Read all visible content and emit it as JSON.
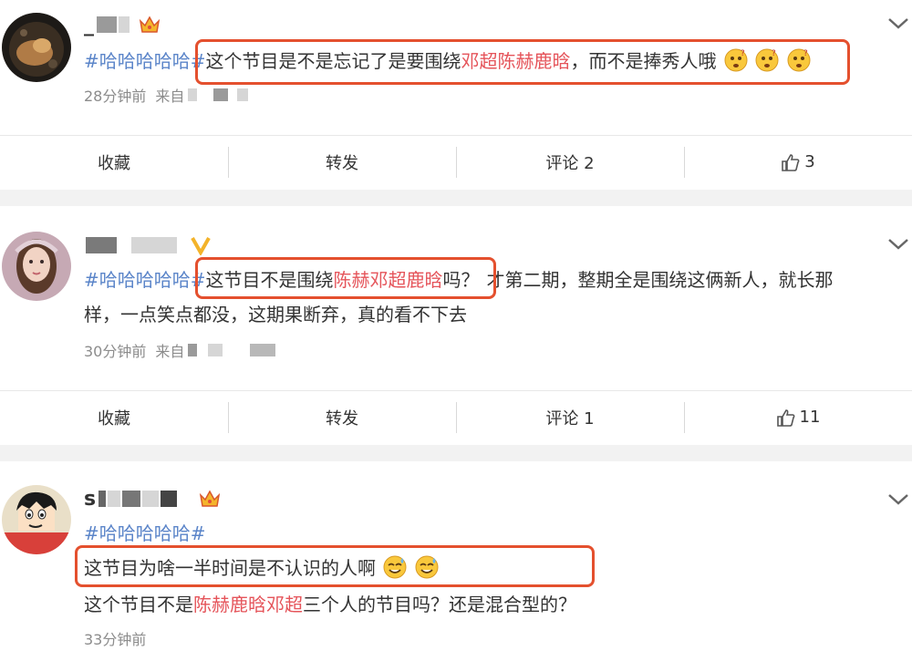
{
  "posts": [
    {
      "user_name": "_",
      "hashtag": "#哈哈哈哈哈#",
      "text_boxed_pre": "这个节目是不是忘记了是要围绕",
      "text_boxed_hl": "邓超陈赫鹿晗",
      "text_boxed_post": "，而不是捧秀人哦",
      "text_after": "",
      "time": "28分钟前",
      "source": "来自",
      "actions": {
        "favorite": "收藏",
        "repost": "转发",
        "comment": "评论 2",
        "like_count": "3"
      }
    },
    {
      "user_name": "",
      "hashtag": "#哈哈哈哈哈#",
      "text_boxed_pre": "这节目不是围绕",
      "text_boxed_hl": "陈赫邓超鹿晗",
      "text_boxed_post": "吗？",
      "text_after_line1": "才第二期，整期全是围绕这俩新人，就长那",
      "text_after_line2": "样，一点笑点都没，这期果断弃，真的看不下去",
      "time": "30分钟前",
      "source": "来自",
      "actions": {
        "favorite": "收藏",
        "repost": "转发",
        "comment": "评论 1",
        "like_count": "11"
      }
    },
    {
      "user_name": "s",
      "hashtag": "#哈哈哈哈哈#",
      "text_boxed": "这节目为啥一半时间是不认识的人啊",
      "text_line2_pre": "这个节目不是",
      "text_line2_hl": "陈赫鹿晗邓超",
      "text_line2_post": "三个人的节目吗？还是混合型的？",
      "time": "33分钟前"
    }
  ],
  "icons": {
    "expand": "chevron-down-icon",
    "like": "thumbs-up-icon",
    "member": "crown-icon",
    "verified": "v-badge-icon",
    "emoji_question": "confused-face-icon",
    "emoji_sweat": "sweat-smile-icon"
  },
  "colors": {
    "hashtag": "#5b85c9",
    "highlight": "#e5545a",
    "annotation_box": "#e4502e",
    "meta_text": "#8c8c8c",
    "separator": "#f2f2f2"
  }
}
